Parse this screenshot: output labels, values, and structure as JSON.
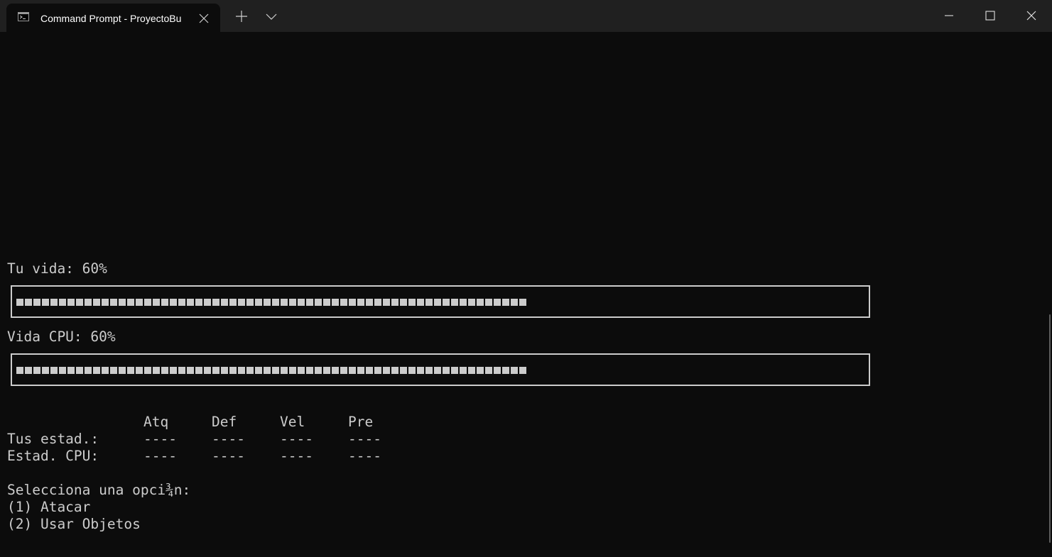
{
  "window": {
    "tab_title": "Command Prompt - ProyectoBu",
    "tab_icon": "cmd-icon",
    "buttons": [
      "new-tab-icon",
      "dropdown-chevron-icon",
      "minimize-icon",
      "maximize-icon",
      "close-icon"
    ]
  },
  "terminal": {
    "player_hp_label": "Tu vida: 60%",
    "player_hp_fraction": 0.6,
    "cpu_hp_label": "Vida CPU: 60%",
    "cpu_hp_fraction": 0.6,
    "stats": {
      "headers": [
        "Atq",
        "Def",
        "Vel",
        "Pre"
      ],
      "rows": [
        {
          "label": "Tus estad.:",
          "values": [
            "----",
            "----",
            "----",
            "----"
          ]
        },
        {
          "label": "Estad. CPU:",
          "values": [
            "----",
            "----",
            "----",
            "----"
          ]
        }
      ]
    },
    "menu": {
      "prompt": "Selecciona una opci¾n:",
      "options": [
        "(1) Atacar",
        "(2) Usar Objetos"
      ]
    }
  },
  "colors": {
    "background": "#0c0c0c",
    "titlebar": "#202020",
    "text": "#cccccc"
  }
}
